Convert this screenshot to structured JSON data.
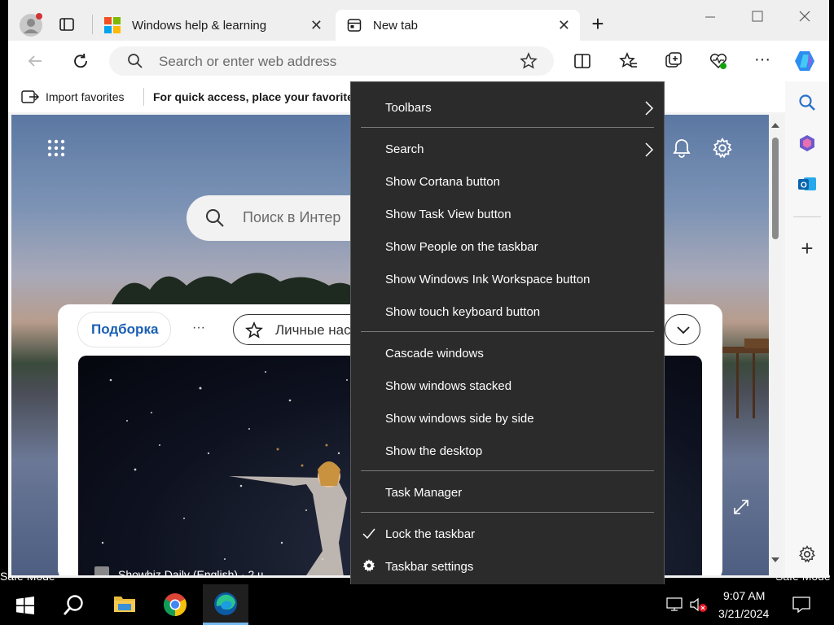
{
  "browser": {
    "tabs": [
      {
        "label": "Windows help & learning",
        "active": false
      },
      {
        "label": "New tab",
        "active": true
      }
    ],
    "address_placeholder": "Search or enter web address",
    "favorites": {
      "import_label": "Import favorites",
      "hint": "For quick access, place your favorite"
    }
  },
  "newtab": {
    "search_placeholder": "Поиск в Интер",
    "feed_tab_active": "Подборка",
    "feed_more": "···",
    "feed_personal": "Личные нас",
    "card_source": "Showbiz Daily (English) · 2 ч"
  },
  "context_menu": {
    "items": [
      {
        "label": "Toolbars",
        "submenu": true
      },
      {
        "label": "Search",
        "submenu": true
      },
      {
        "label": "Show Cortana button"
      },
      {
        "label": "Show Task View button"
      },
      {
        "label": "Show People on the taskbar"
      },
      {
        "label": "Show Windows Ink Workspace button"
      },
      {
        "label": "Show touch keyboard button"
      },
      {
        "label": "Cascade windows"
      },
      {
        "label": "Show windows stacked"
      },
      {
        "label": "Show windows side by side"
      },
      {
        "label": "Show the desktop"
      },
      {
        "label": "Task Manager"
      },
      {
        "label": "Lock the taskbar",
        "checked": true
      },
      {
        "label": "Taskbar settings",
        "icon": "gear-icon"
      }
    ]
  },
  "desktop": {
    "safe_mode": "Safe Mode"
  },
  "taskbar": {
    "time": "9:07 AM",
    "date": "3/21/2024",
    "pinned": [
      "windows-start-icon",
      "search-icon",
      "file-explorer-icon",
      "chrome-icon",
      "edge-icon"
    ]
  },
  "colors": {
    "menu_bg": "#2b2b2b",
    "accent": "#0078d4",
    "taskbar": "#000000"
  }
}
